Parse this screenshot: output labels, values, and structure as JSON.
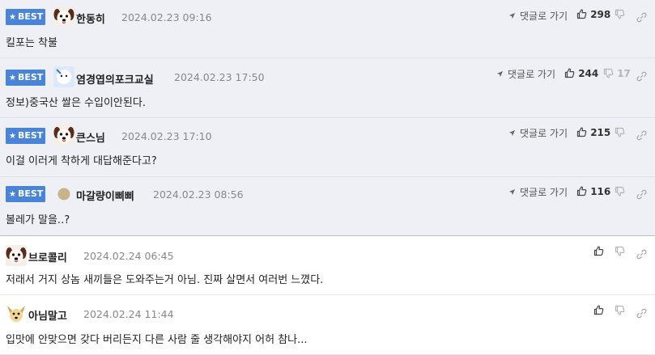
{
  "labels": {
    "best": "BEST",
    "reply": "댓글로 가기"
  },
  "colors": {
    "best_bg": "#eef0f6",
    "badge": "#4a84d9",
    "date": "#888888"
  },
  "comments": [
    {
      "nick": "한동히",
      "date": "2024.02.23 09:16",
      "text": "킬포는 착불",
      "likes": "298",
      "dislikes": "",
      "avatar": "dog-face-icon"
    },
    {
      "nick": "염경엽의포크교실",
      "date": "2024.02.23 17:50",
      "text": "정보)중국산 쌀은 수입이안된다.",
      "likes": "244",
      "dislikes": "17",
      "avatar": "blue-character-icon"
    },
    {
      "nick": "큰스님",
      "date": "2024.02.23 17:10",
      "text": "이걸 이러게 착하게 대답해준다고?",
      "likes": "215",
      "dislikes": "",
      "avatar": "dog-face-icon"
    },
    {
      "nick": "마갈량이삐삐",
      "date": "2024.02.23 08:56",
      "text": "볼레가 말을..?",
      "likes": "116",
      "dislikes": "",
      "avatar": "round-dot-icon"
    },
    {
      "nick": "브로콜리",
      "date": "2024.02.24 06:45",
      "text": "저래서 거지 상놈 새끼들은 도와주는거 아님. 진짜 살면서 여러번 느꼈다.",
      "likes": "",
      "dislikes": "",
      "avatar": "dog-face-icon"
    },
    {
      "nick": "아님말고",
      "date": "2024.02.24 11:44",
      "text": "입맛에 안맞으면 갖다 버리든지 다른 사람 줄 생각해야지 어허 참나...",
      "likes": "",
      "dislikes": "",
      "avatar": "puppy-icon"
    }
  ]
}
